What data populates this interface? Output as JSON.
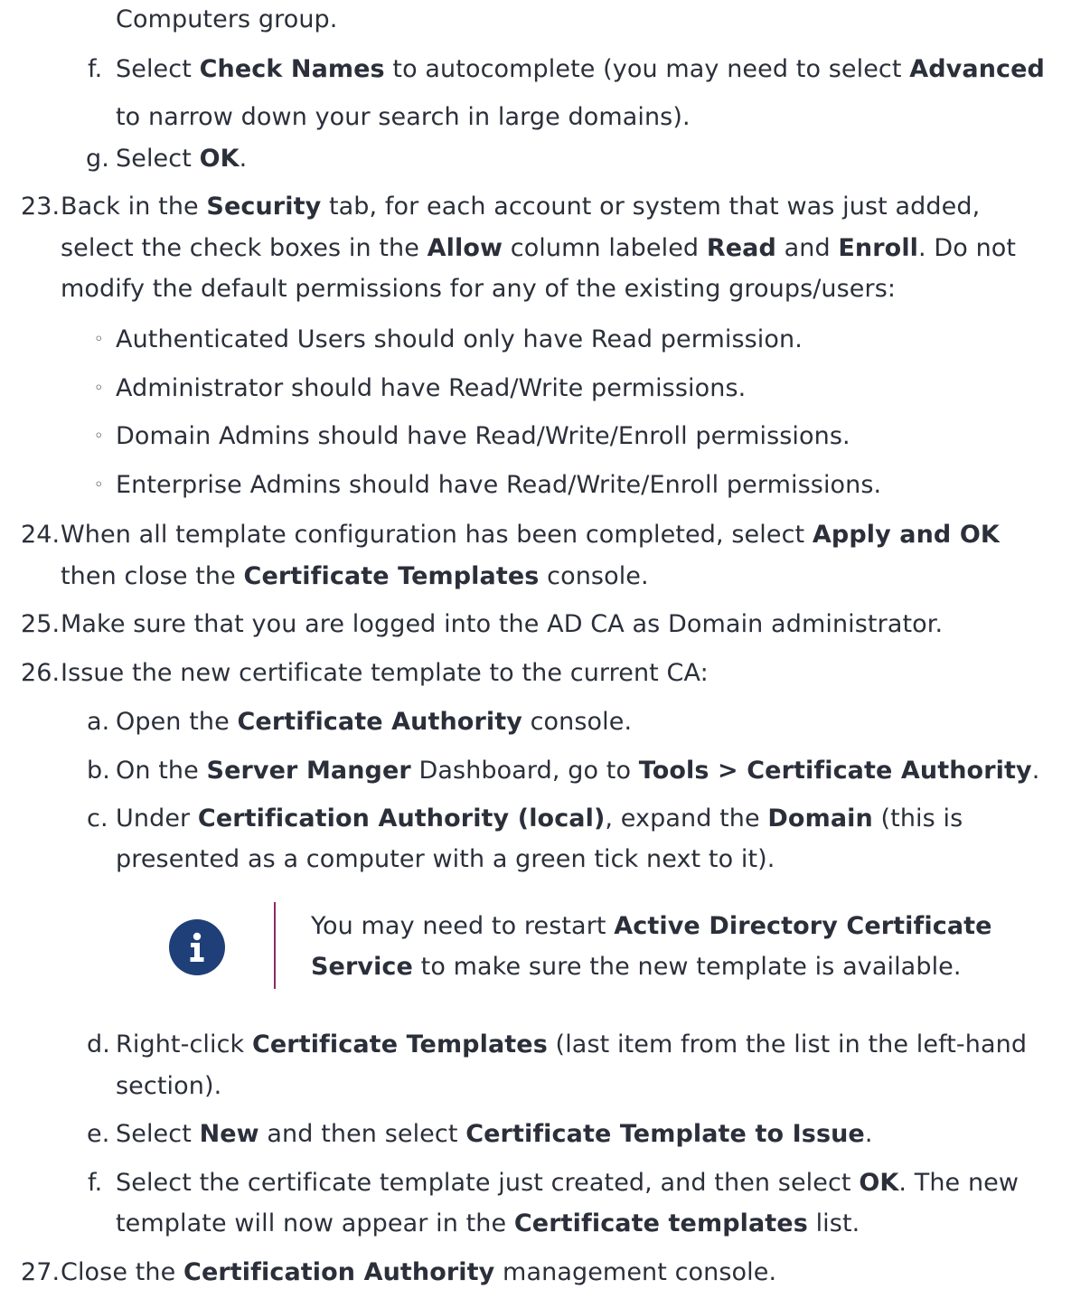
{
  "top": {
    "cont": "Computers group."
  },
  "step22": {
    "f": {
      "marker": "f.",
      "l1_p1": "Select ",
      "l1_b1": "Check Names",
      "l1_p2": " to autocomplete (you may need to select ",
      "l1_b2": "Advanced",
      "l2": "to narrow down your search in large domains)."
    },
    "g": {
      "marker": "g.",
      "p1": "Select ",
      "b1": "OK",
      "p2": "."
    }
  },
  "step23": {
    "marker": "23.",
    "l1_p1": "Back in the ",
    "l1_b1": "Security",
    "l1_p2": " tab, for each account or system that was just added,",
    "l2_p1": "select the check boxes in the ",
    "l2_b1": "Allow",
    "l2_p2": " column labeled ",
    "l2_b2": "Read",
    "l2_p3": " and ",
    "l2_b3": "Enroll",
    "l2_p4": ". Do not",
    "l3": "modify the default permissions for any of the existing groups/users:",
    "bullets": [
      "Authenticated Users should only have Read permission.",
      "Administrator should have Read/Write permissions.",
      "Domain Admins should have Read/Write/Enroll permissions.",
      "Enterprise Admins should have Read/Write/Enroll permissions."
    ]
  },
  "step24": {
    "marker": "24.",
    "l1_p1": "When all template configuration has been completed, select ",
    "l1_b1": "Apply and OK",
    "l2_p1": "then close the ",
    "l2_b1": "Certificate Templates",
    "l2_p2": " console."
  },
  "step25": {
    "marker": "25.",
    "text": "Make sure that you are logged into the AD CA as Domain administrator."
  },
  "step26": {
    "marker": "26.",
    "text": "Issue the new certificate template to the current CA:",
    "a": {
      "marker": "a.",
      "p1": "Open the ",
      "b1": "Certificate Authority",
      "p2": " console."
    },
    "b": {
      "marker": "b.",
      "p1": "On the ",
      "b1": "Server Manger",
      "p2": " Dashboard, go to ",
      "b2": "Tools > Certificate Authority",
      "p3": "."
    },
    "c": {
      "marker": "c.",
      "l1_p1": "Under ",
      "l1_b1": "Certification Authority (local)",
      "l1_p2": ", expand the ",
      "l1_b2": "Domain",
      "l1_p3": " (this is",
      "l2": "presented as a computer with a green tick next to it)."
    },
    "note": {
      "l1_p1": "You may need to restart ",
      "l1_b1": "Active Directory Certificate",
      "l2_b1": "Service",
      "l2_p1": " to make sure the new template is available."
    },
    "d": {
      "marker": "d.",
      "l1_p1": "Right-click ",
      "l1_b1": "Certificate Templates",
      "l1_p2": " (last item from the list in the left-hand",
      "l2": "section)."
    },
    "e": {
      "marker": "e.",
      "p1": "Select ",
      "b1": "New",
      "p2": " and then select ",
      "b2": "Certificate Template to Issue",
      "p3": "."
    },
    "f": {
      "marker": "f.",
      "l1_p1": "Select the certificate template just created, and then select ",
      "l1_b1": "OK",
      "l1_p2": ". The new",
      "l2_p1": "template will now appear in the ",
      "l2_b1": "Certificate templates",
      "l2_p2": " list."
    }
  },
  "step27": {
    "marker": "27.",
    "p1": "Close the ",
    "b1": "Certification Authority",
    "p2": " management console."
  },
  "colors": {
    "text": "#2b2f3a",
    "icon_bg": "#1f3f78",
    "note_bar": "#8a2a64"
  },
  "icons": {
    "note": "info-icon"
  }
}
